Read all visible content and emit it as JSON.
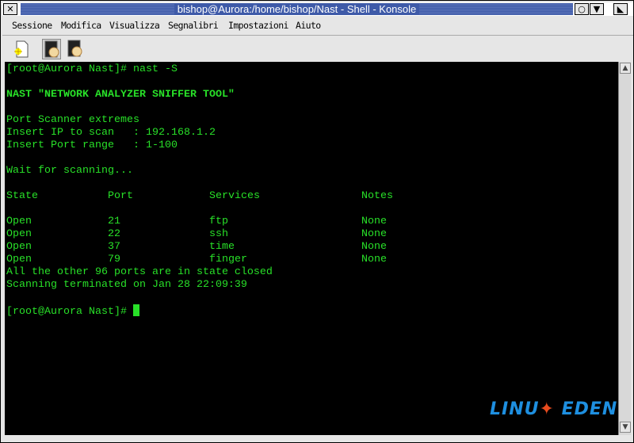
{
  "window": {
    "title": "bishop@Aurora:/home/bishop/Nast - Shell - Konsole"
  },
  "menubar": [
    "Sessione",
    "Modifica",
    "Visualizza",
    "Segnalibri",
    "Impostazioni",
    "Aiuto"
  ],
  "toolbar": {
    "icons": [
      "new-session-icon",
      "shell-session-icon",
      "shell-session-icon"
    ]
  },
  "terminal": {
    "lines": [
      "[root@Aurora Nast]# nast -S",
      "",
      "NAST \"NETWORK ANALYZER SNIFFER TOOL\"",
      "",
      "Port Scanner extremes",
      "Insert IP to scan   : 192.168.1.2",
      "Insert Port range   : 1-100",
      "",
      "Wait for scanning...",
      ""
    ],
    "table": {
      "headers": [
        "State",
        "Port",
        "Services",
        "Notes"
      ],
      "rows": [
        [
          "Open",
          "21",
          "ftp",
          "None"
        ],
        [
          "Open",
          "22",
          "ssh",
          "None"
        ],
        [
          "Open",
          "37",
          "time",
          "None"
        ],
        [
          "Open",
          "79",
          "finger",
          "None"
        ]
      ]
    },
    "footer_lines": [
      "All the other 96 ports are in state closed",
      "Scanning terminated on Jan 28 22:09:39",
      ""
    ],
    "prompt": "[root@Aurora Nast]# ",
    "text_color": "#28e028",
    "background": "#000000"
  },
  "watermark": {
    "text": "LINUX EDEN"
  }
}
